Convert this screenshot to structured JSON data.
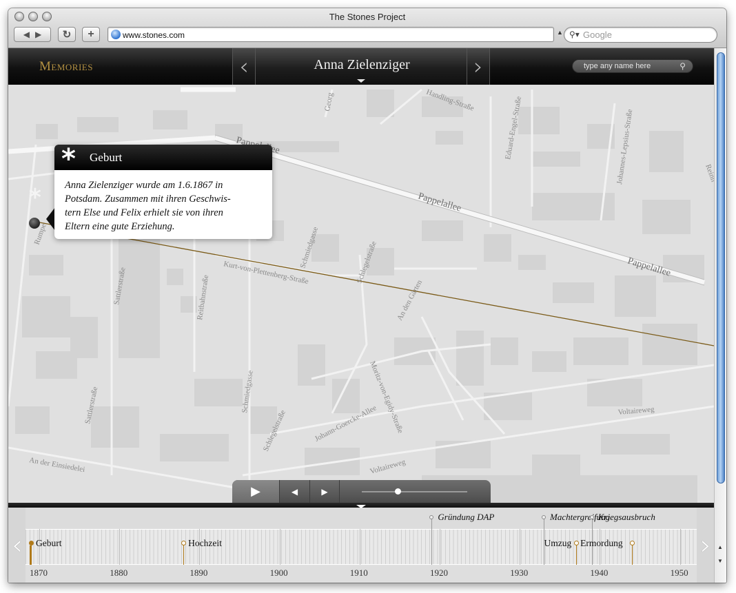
{
  "window": {
    "title": "The Stones Project",
    "url": "www.stones.com",
    "search_placeholder": "Google"
  },
  "header": {
    "section": "Memories",
    "person_name": "Anna Zielenziger",
    "search_placeholder": "type any name here"
  },
  "popup": {
    "title": "Geburt",
    "text_lines": [
      "Anna Zielenziger wurde am 1.6.1867 in",
      "Potsdam. Zusammen mit ihren Geschwis-",
      "tern Else und Felix erhielt sie von ihren",
      "Eltern eine gute Erziehung."
    ]
  },
  "map": {
    "route_color": "#7a5a17",
    "streets": [
      "Pappelallee",
      "Pappelallee",
      "Pappelallee",
      "Kurt-von-Plettenberg-Straße",
      "Schlegelstraße",
      "Schlegelstraße",
      "Schmiedgasse",
      "Schmiedgasse",
      "Reitbahnstraße",
      "Sattlerstraße",
      "Sattlerstraße",
      "An den Gärten",
      "Moritz-von-Egidy-Straße",
      "Johann-Goercke-Allee",
      "Voltaireweg",
      "Voltaireweg",
      "An der Einsiedelei",
      "Eduard-Engel-Straße",
      "Johannes-Lepsius-Straße",
      "Handling-Straße",
      "Georg",
      "Rumpe",
      "Reinh"
    ]
  },
  "timeline": {
    "years": [
      "1870",
      "1880",
      "1890",
      "1900",
      "1910",
      "1920",
      "1930",
      "1940",
      "1950"
    ],
    "personal_events": [
      {
        "label": "Geburt",
        "year": 1867
      },
      {
        "label": "Hochzeit",
        "year": 1888
      },
      {
        "label": "Umzug",
        "year": 1937
      },
      {
        "label": "Ermordung",
        "year": 1944
      }
    ],
    "historical_events": [
      {
        "label": "Gründung DAP",
        "year": 1919
      },
      {
        "label": "Machtergreifung",
        "year": 1933
      },
      {
        "label": "Kriegsausbruch",
        "year": 1939
      }
    ],
    "accent_color": "#b07a1a"
  }
}
